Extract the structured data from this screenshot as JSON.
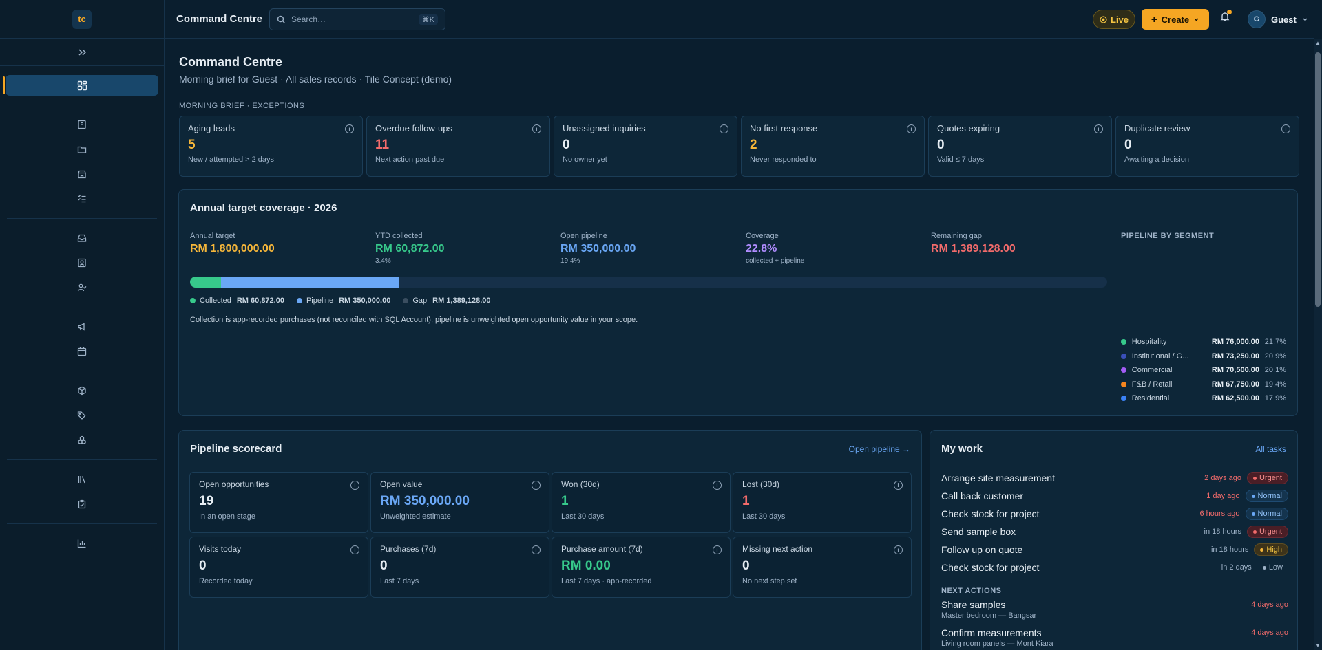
{
  "logo": "tc",
  "topbar": {
    "title": "Command Centre",
    "search_placeholder": "Search…",
    "search_shortcut": "⌘K",
    "live_label": "Live",
    "create_label": "Create",
    "user_initial": "G",
    "user_name": "Guest"
  },
  "page": {
    "title": "Command Centre",
    "subtitle": "Morning brief for Guest · All sales records · Tile Concept (demo)",
    "brief_label": "MORNING BRIEF · EXCEPTIONS"
  },
  "morning_brief": [
    {
      "label": "Aging leads",
      "value": "5",
      "sub": "New / attempted > 2 days",
      "color": "#f5b63a"
    },
    {
      "label": "Overdue follow-ups",
      "value": "11",
      "sub": "Next action past due",
      "color": "#f26b6b"
    },
    {
      "label": "Unassigned inquiries",
      "value": "0",
      "sub": "No owner yet",
      "color": "#e6edf3"
    },
    {
      "label": "No first response",
      "value": "2",
      "sub": "Never responded to",
      "color": "#f5b63a"
    },
    {
      "label": "Quotes expiring",
      "value": "0",
      "sub": "Valid ≤ 7 days",
      "color": "#e6edf3"
    },
    {
      "label": "Duplicate review",
      "value": "0",
      "sub": "Awaiting a decision",
      "color": "#e6edf3"
    }
  ],
  "annual": {
    "title": "Annual target coverage · 2026",
    "target_label": "Annual target",
    "target_value": "RM 1,800,000.00",
    "ytd_label": "YTD collected",
    "ytd_value": "RM 60,872.00",
    "ytd_sub": "3.4%",
    "pipeline_label": "Open pipeline",
    "pipeline_value": "RM 350,000.00",
    "pipeline_sub": "19.4%",
    "coverage_label": "Coverage",
    "coverage_value": "22.8%",
    "coverage_sub": "collected + pipeline",
    "gap_label": "Remaining gap",
    "gap_value": "RM 1,389,128.00",
    "progress": {
      "collected_pct": 3.4,
      "pipeline_pct": 19.4
    },
    "legend": {
      "collected_label": "Collected",
      "collected_value": "RM 60,872.00",
      "pipeline_label": "Pipeline",
      "pipeline_value": "RM 350,000.00",
      "gap_label": "Gap",
      "gap_value": "RM 1,389,128.00"
    },
    "note": "Collection is app-recorded purchases (not reconciled with SQL Account); pipeline is unweighted open opportunity value in your scope.",
    "segments_label": "PIPELINE BY SEGMENT",
    "segments": [
      {
        "name": "Hospitality",
        "value": "RM 76,000.00",
        "pct": "21.7%",
        "color": "#37c98b"
      },
      {
        "name": "Institutional / G...",
        "value": "RM 73,250.00",
        "pct": "20.9%",
        "color": "#3a4fb8"
      },
      {
        "name": "Commercial",
        "value": "RM 70,500.00",
        "pct": "20.1%",
        "color": "#a35cf5"
      },
      {
        "name": "F&B / Retail",
        "value": "RM 67,750.00",
        "pct": "19.4%",
        "color": "#f5851f"
      },
      {
        "name": "Residential",
        "value": "RM 62,500.00",
        "pct": "17.9%",
        "color": "#3b82f6"
      }
    ]
  },
  "scorecard": {
    "title": "Pipeline scorecard",
    "link": "Open pipeline →",
    "cards": [
      {
        "label": "Open opportunities",
        "value": "19",
        "sub": "In an open stage",
        "color": "#e6edf3"
      },
      {
        "label": "Open value",
        "value": "RM 350,000.00",
        "sub": "Unweighted estimate",
        "color": "#6aa7f5"
      },
      {
        "label": "Won (30d)",
        "value": "1",
        "sub": "Last 30 days",
        "color": "#37c98b"
      },
      {
        "label": "Lost (30d)",
        "value": "1",
        "sub": "Last 30 days",
        "color": "#f26b6b"
      },
      {
        "label": "Visits today",
        "value": "0",
        "sub": "Recorded today",
        "color": "#e6edf3"
      },
      {
        "label": "Purchases (7d)",
        "value": "0",
        "sub": "Last 7 days",
        "color": "#e6edf3"
      },
      {
        "label": "Purchase amount (7d)",
        "value": "RM 0.00",
        "sub": "Last 7 days · app-recorded",
        "color": "#37c98b"
      },
      {
        "label": "Missing next action",
        "value": "0",
        "sub": "No next step set",
        "color": "#e6edf3"
      }
    ]
  },
  "mywork": {
    "title": "My work",
    "link": "All tasks",
    "tasks": [
      {
        "name": "Arrange site measurement",
        "time": "2 days ago",
        "priority": "Urgent",
        "kind": "urgent",
        "time_color": "#f26b6b"
      },
      {
        "name": "Call back customer",
        "time": "1 day ago",
        "priority": "Normal",
        "kind": "normal",
        "time_color": "#f26b6b"
      },
      {
        "name": "Check stock for project",
        "time": "6 hours ago",
        "priority": "Normal",
        "kind": "normal",
        "time_color": "#f26b6b"
      },
      {
        "name": "Send sample box",
        "time": "in 18 hours",
        "priority": "Urgent",
        "kind": "urgent",
        "time_color": "#9fb3c8"
      },
      {
        "name": "Follow up on quote",
        "time": "in 18 hours",
        "priority": "High",
        "kind": "high",
        "time_color": "#9fb3c8"
      },
      {
        "name": "Check stock for project",
        "time": "in 2 days",
        "priority": "Low",
        "kind": "low",
        "time_color": "#9fb3c8"
      }
    ],
    "next_label": "NEXT ACTIONS",
    "next_actions": [
      {
        "title": "Share samples",
        "sub": "Master bedroom — Bangsar",
        "due": "4 days ago"
      },
      {
        "title": "Confirm measurements",
        "sub": "Living room panels — Mont Kiara",
        "due": "4 days ago"
      }
    ]
  }
}
